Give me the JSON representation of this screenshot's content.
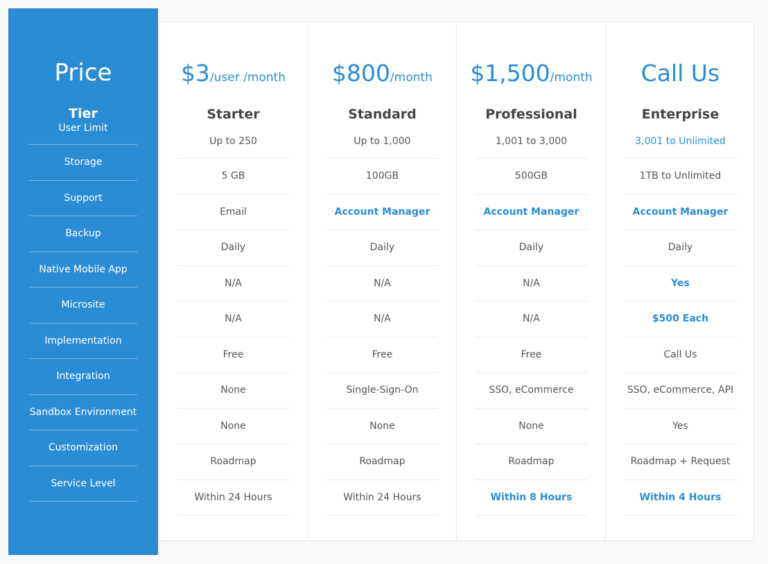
{
  "colors": {
    "accent": "#2b8cd6",
    "text": "#555555",
    "heading": "#444444",
    "background": "#f8f9fb"
  },
  "sidebar": {
    "price_label": "Price",
    "tier_label": "Tier",
    "features": [
      "User Limit",
      "Storage",
      "Support",
      "Backup",
      "Native Mobile App",
      "Microsite",
      "Implementation",
      "Integration",
      "Sandbox Environment",
      "Customization",
      "Service Level"
    ]
  },
  "plans": [
    {
      "price": "$3",
      "unit": "/user /month",
      "tier": "Starter",
      "values": [
        {
          "text": "Up to 250",
          "style": ""
        },
        {
          "text": "5 GB",
          "style": ""
        },
        {
          "text": "Email",
          "style": ""
        },
        {
          "text": "Daily",
          "style": ""
        },
        {
          "text": "N/A",
          "style": ""
        },
        {
          "text": "N/A",
          "style": ""
        },
        {
          "text": "Free",
          "style": ""
        },
        {
          "text": "None",
          "style": ""
        },
        {
          "text": "None",
          "style": ""
        },
        {
          "text": "Roadmap",
          "style": ""
        },
        {
          "text": "Within 24 Hours",
          "style": ""
        }
      ]
    },
    {
      "price": "$800",
      "unit": "/month",
      "tier": "Standard",
      "values": [
        {
          "text": "Up to 1,000",
          "style": ""
        },
        {
          "text": "100GB",
          "style": ""
        },
        {
          "text": "Account Manager",
          "style": "hl bold"
        },
        {
          "text": "Daily",
          "style": ""
        },
        {
          "text": "N/A",
          "style": ""
        },
        {
          "text": "N/A",
          "style": ""
        },
        {
          "text": "Free",
          "style": ""
        },
        {
          "text": "Single-Sign-On",
          "style": ""
        },
        {
          "text": "None",
          "style": ""
        },
        {
          "text": "Roadmap",
          "style": ""
        },
        {
          "text": "Within 24 Hours",
          "style": ""
        }
      ]
    },
    {
      "price": "$1,500",
      "unit": "/month",
      "tier": "Professional",
      "values": [
        {
          "text": "1,001 to 3,000",
          "style": ""
        },
        {
          "text": "500GB",
          "style": ""
        },
        {
          "text": "Account Manager",
          "style": "hl bold"
        },
        {
          "text": "Daily",
          "style": ""
        },
        {
          "text": "N/A",
          "style": ""
        },
        {
          "text": "N/A",
          "style": ""
        },
        {
          "text": "Free",
          "style": ""
        },
        {
          "text": "SSO, eCommerce",
          "style": ""
        },
        {
          "text": "None",
          "style": ""
        },
        {
          "text": "Roadmap",
          "style": ""
        },
        {
          "text": "Within 8 Hours",
          "style": "hl bold"
        }
      ]
    },
    {
      "price": "Call Us",
      "unit": "",
      "tier": "Enterprise",
      "values": [
        {
          "text": "3,001 to Unlimited",
          "style": "hl"
        },
        {
          "text": "1TB to Unlimited",
          "style": ""
        },
        {
          "text": "Account Manager",
          "style": "hl bold"
        },
        {
          "text": "Daily",
          "style": ""
        },
        {
          "text": "Yes",
          "style": "hl bold"
        },
        {
          "text": "$500 Each",
          "style": "hl bold"
        },
        {
          "text": "Call Us",
          "style": ""
        },
        {
          "text": "SSO, eCommerce, API",
          "style": ""
        },
        {
          "text": "Yes",
          "style": ""
        },
        {
          "text": "Roadmap + Request",
          "style": ""
        },
        {
          "text": "Within 4 Hours",
          "style": "hl bold"
        }
      ]
    }
  ]
}
